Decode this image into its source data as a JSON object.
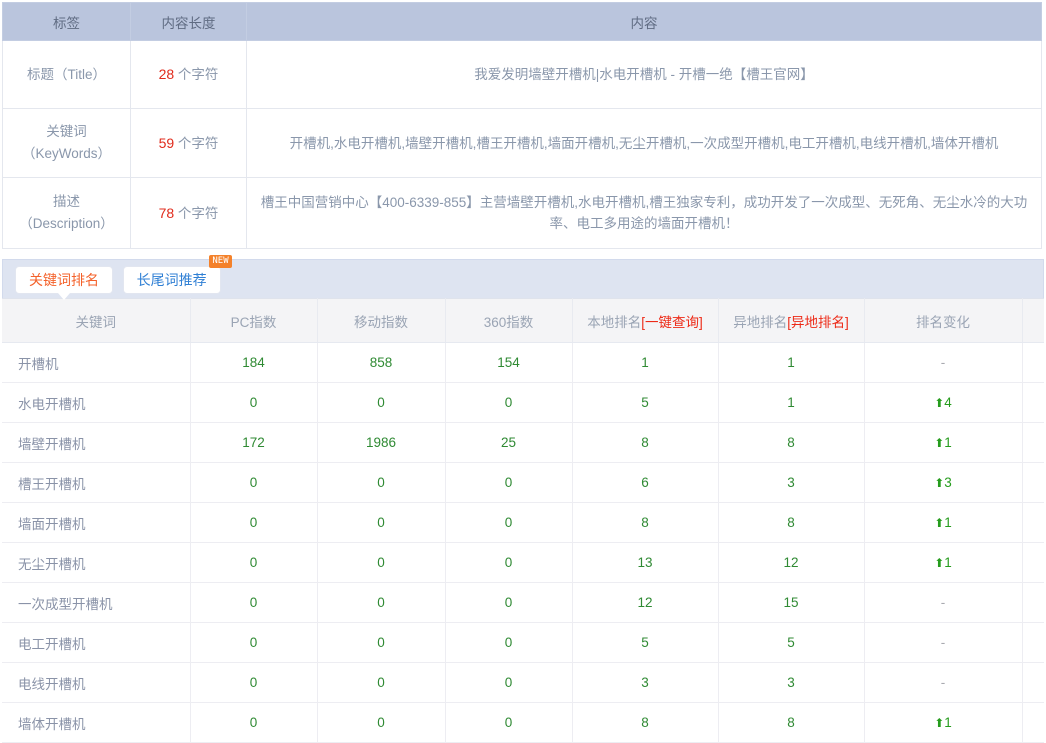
{
  "seo_table": {
    "headers": [
      "标签",
      "内容长度",
      "内容"
    ],
    "rows": [
      {
        "label_cn": "标题",
        "label_en": "（Title）",
        "length_num": "28",
        "length_unit": " 个字符",
        "content": "我爱发明墙壁开槽机|水电开槽机 - 开槽一绝【槽王官网】"
      },
      {
        "label_cn": "关键词",
        "label_en": "（KeyWords）",
        "length_num": "59",
        "length_unit": " 个字符",
        "content": "开槽机,水电开槽机,墙壁开槽机,槽王开槽机,墙面开槽机,无尘开槽机,一次成型开槽机,电工开槽机,电线开槽机,墙体开槽机"
      },
      {
        "label_cn": "描述",
        "label_en": "（Description）",
        "length_num": "78",
        "length_unit": " 个字符",
        "content": "槽王中国营销中心【400-6339-855】主营墙壁开槽机,水电开槽机,槽王独家专利，成功开发了一次成型、无死角、无尘水冷的大功率、电工多用途的墙面开槽机！"
      }
    ]
  },
  "tabs": [
    {
      "label": "关键词排名",
      "active": true,
      "badge": ""
    },
    {
      "label": "长尾词推荐",
      "active": false,
      "badge": "NEW"
    }
  ],
  "rank_table": {
    "headers": [
      {
        "text": "关键词",
        "highlight": ""
      },
      {
        "text": "PC指数",
        "highlight": ""
      },
      {
        "text": "移动指数",
        "highlight": ""
      },
      {
        "text": "360指数",
        "highlight": ""
      },
      {
        "text": "本地排名",
        "highlight": "[一键查询]"
      },
      {
        "text": "异地排名",
        "highlight": "[异地排名]"
      },
      {
        "text": "排名变化",
        "highlight": ""
      },
      {
        "text": "",
        "highlight": ""
      }
    ],
    "rows": [
      {
        "keyword": "开槽机",
        "pc": "184",
        "mobile": "858",
        "so360": "154",
        "local_rank": "1",
        "remote_rank": "1",
        "change": "-",
        "change_dir": "flat"
      },
      {
        "keyword": "水电开槽机",
        "pc": "0",
        "mobile": "0",
        "so360": "0",
        "local_rank": "5",
        "remote_rank": "1",
        "change": "4",
        "change_dir": "up"
      },
      {
        "keyword": "墙壁开槽机",
        "pc": "172",
        "mobile": "1986",
        "so360": "25",
        "local_rank": "8",
        "remote_rank": "8",
        "change": "1",
        "change_dir": "up"
      },
      {
        "keyword": "槽王开槽机",
        "pc": "0",
        "mobile": "0",
        "so360": "0",
        "local_rank": "6",
        "remote_rank": "3",
        "change": "3",
        "change_dir": "up"
      },
      {
        "keyword": "墙面开槽机",
        "pc": "0",
        "mobile": "0",
        "so360": "0",
        "local_rank": "8",
        "remote_rank": "8",
        "change": "1",
        "change_dir": "up"
      },
      {
        "keyword": "无尘开槽机",
        "pc": "0",
        "mobile": "0",
        "so360": "0",
        "local_rank": "13",
        "remote_rank": "12",
        "change": "1",
        "change_dir": "up"
      },
      {
        "keyword": "一次成型开槽机",
        "pc": "0",
        "mobile": "0",
        "so360": "0",
        "local_rank": "12",
        "remote_rank": "15",
        "change": "-",
        "change_dir": "flat"
      },
      {
        "keyword": "电工开槽机",
        "pc": "0",
        "mobile": "0",
        "so360": "0",
        "local_rank": "5",
        "remote_rank": "5",
        "change": "-",
        "change_dir": "flat"
      },
      {
        "keyword": "电线开槽机",
        "pc": "0",
        "mobile": "0",
        "so360": "0",
        "local_rank": "3",
        "remote_rank": "3",
        "change": "-",
        "change_dir": "flat"
      },
      {
        "keyword": "墙体开槽机",
        "pc": "0",
        "mobile": "0",
        "so360": "0",
        "local_rank": "8",
        "remote_rank": "8",
        "change": "1",
        "change_dir": "up"
      }
    ]
  },
  "colors": {
    "header_blue": "#bac5dd",
    "tab_active": "#f4612a",
    "tab_inactive": "#2f7fd4",
    "badge": "#f4812a",
    "number_green": "#2f8a33",
    "length_red": "#e02b1c",
    "header_highlight_red": "#ed2a17"
  }
}
